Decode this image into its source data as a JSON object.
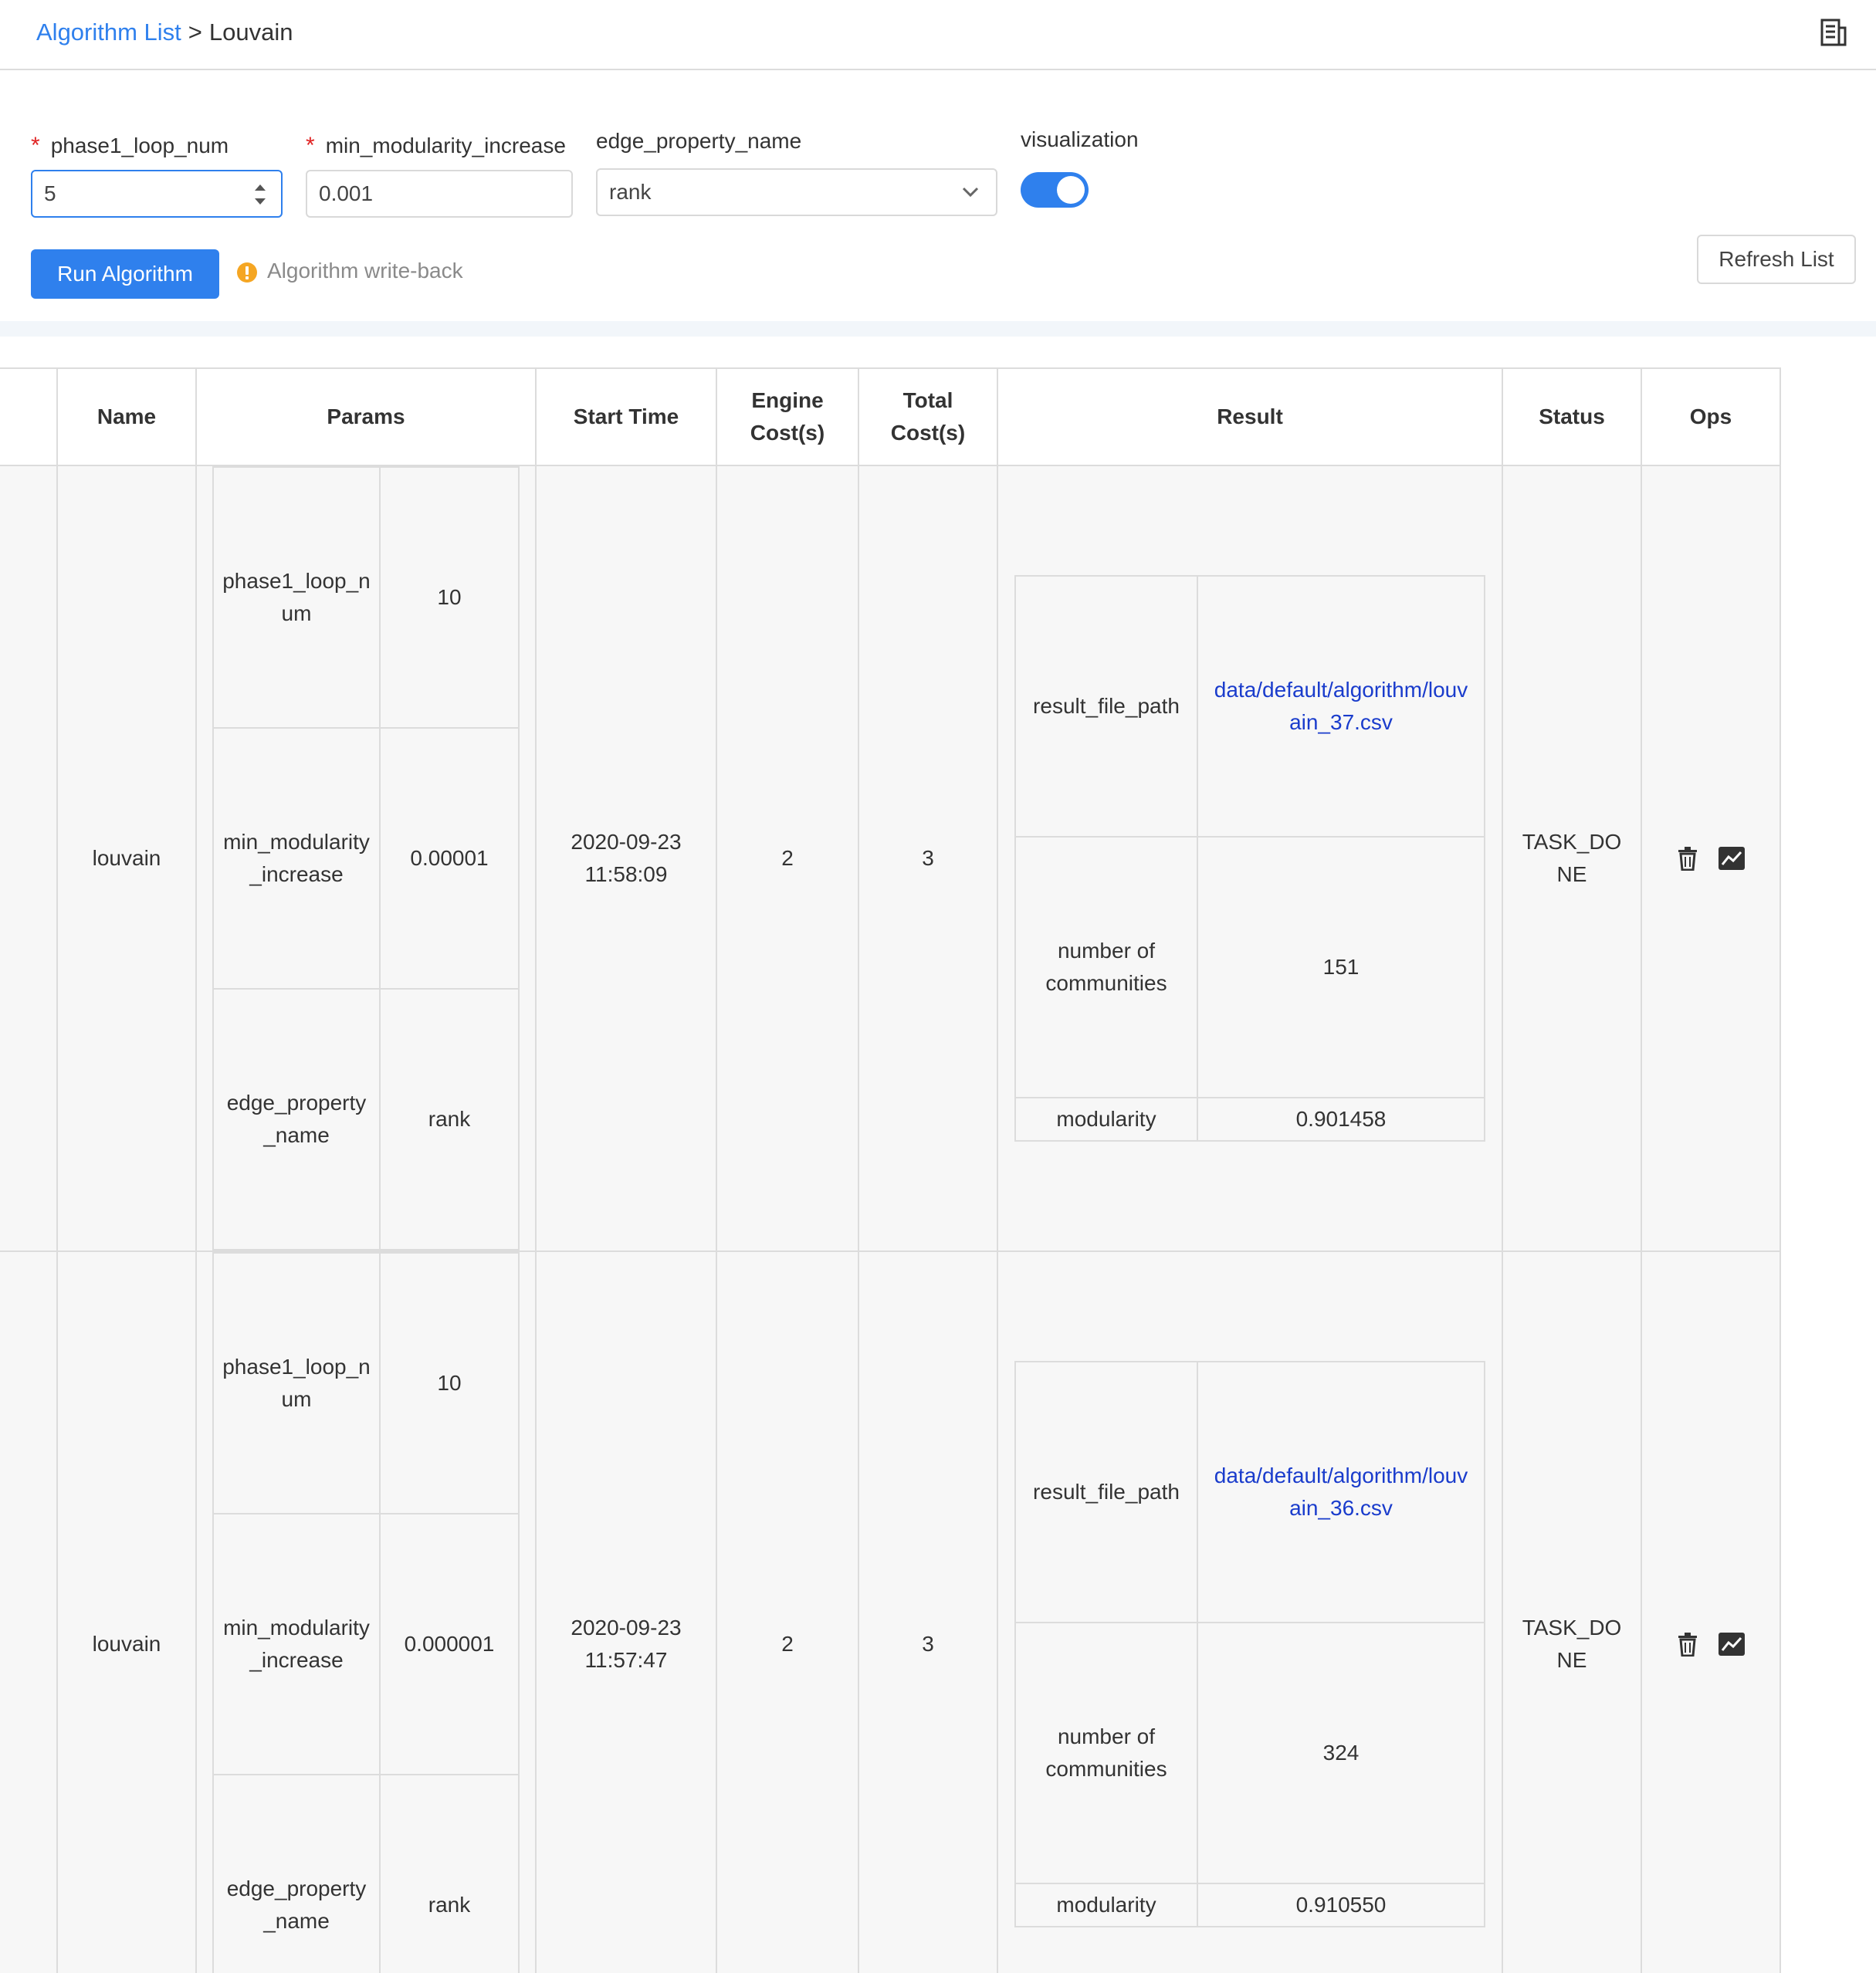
{
  "breadcrumb": {
    "parent": "Algorithm List",
    "separator": ">",
    "current": "Louvain"
  },
  "header": {
    "doc_icon": "document-icon"
  },
  "form": {
    "phase1_loop_num": {
      "label": "phase1_loop_num",
      "required_mark": "*",
      "value": "5"
    },
    "min_modularity_increase": {
      "label": "min_modularity_increase",
      "required_mark": "*",
      "value": "0.001"
    },
    "edge_property_name": {
      "label": "edge_property_name",
      "value": "rank"
    },
    "visualization": {
      "label": "visualization",
      "enabled": true
    },
    "run_button": "Run Algorithm",
    "writeback_text": "Algorithm write-back",
    "refresh_button": "Refresh List"
  },
  "colors": {
    "accent": "#2f80ed",
    "warning": "#f5a623",
    "required": "#e02424",
    "link": "#1a3ccc"
  },
  "table": {
    "columns": [
      "Name",
      "Params",
      "Start Time",
      "Engine Cost(s)",
      "Total Cost(s)",
      "Result",
      "Status",
      "Ops"
    ],
    "column_lines": {
      "engine": [
        "Engine",
        "Cost(s)"
      ],
      "total": [
        "Total",
        "Cost(s)"
      ]
    },
    "rows": [
      {
        "name": "louvain",
        "params": [
          {
            "key_a": "phase1_loop_n",
            "key_b": "um",
            "value": "10"
          },
          {
            "key_a": "min_modularity",
            "key_b": "_increase",
            "value": "0.00001"
          },
          {
            "key_a": "edge_property",
            "key_b": "_name",
            "value": "rank"
          }
        ],
        "start_date": "2020-09-23",
        "start_time": "11:58:09",
        "engine_cost": "2",
        "total_cost": "3",
        "result": {
          "file_key": "result_file_path",
          "file_a": "data/default/algorithm/louv",
          "file_b": "ain_37.csv",
          "communities_a": "number of",
          "communities_b": "communities",
          "communities_value": "151",
          "modularity_key": "modularity",
          "modularity_value": "0.901458"
        },
        "status_a": "TASK_DO",
        "status_b": "NE"
      },
      {
        "name": "louvain",
        "params": [
          {
            "key_a": "phase1_loop_n",
            "key_b": "um",
            "value": "10"
          },
          {
            "key_a": "min_modularity",
            "key_b": "_increase",
            "value": "0.000001"
          },
          {
            "key_a": "edge_property",
            "key_b": "_name",
            "value": "rank"
          }
        ],
        "start_date": "2020-09-23",
        "start_time": "11:57:47",
        "engine_cost": "2",
        "total_cost": "3",
        "result": {
          "file_key": "result_file_path",
          "file_a": "data/default/algorithm/louv",
          "file_b": "ain_36.csv",
          "communities_a": "number of",
          "communities_b": "communities",
          "communities_value": "324",
          "modularity_key": "modularity",
          "modularity_value": "0.910550"
        },
        "status_a": "TASK_DO",
        "status_b": "NE"
      }
    ]
  }
}
